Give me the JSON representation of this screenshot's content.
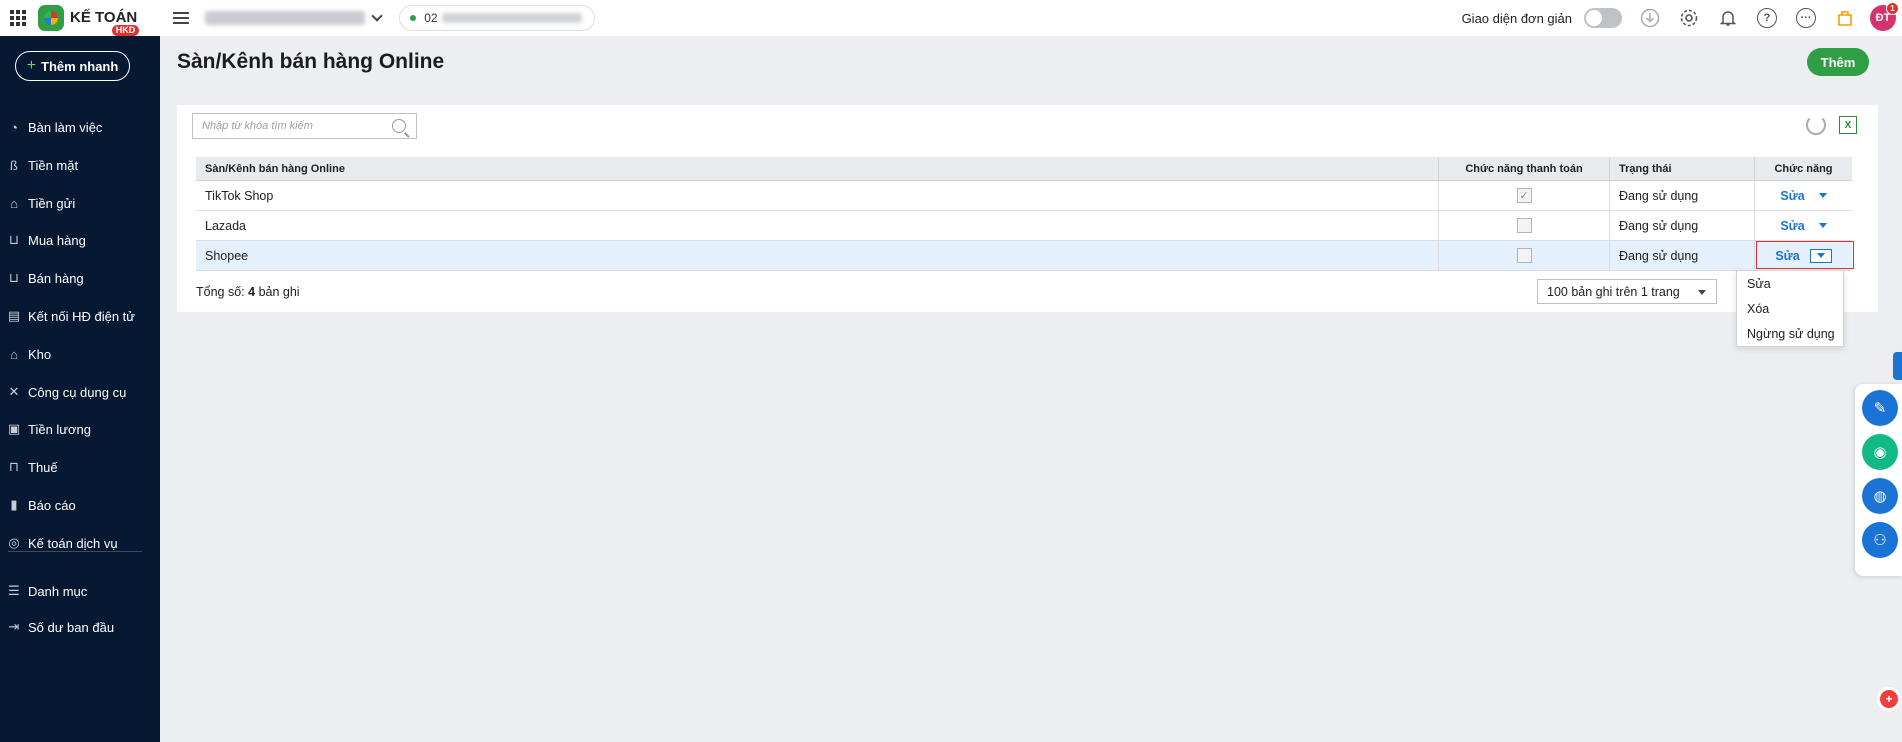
{
  "app": {
    "logo_text": "KẾ TOÁN",
    "logo_sub": "HKD"
  },
  "header": {
    "phone_prefix": "02",
    "simple_ui_label": "Giao diện đơn giản",
    "avatar_initials": "ĐT",
    "notification_badge": "1"
  },
  "sidebar": {
    "quick_add": "Thêm nhanh",
    "items": [
      {
        "label": "Bàn làm việc",
        "icon": "dashboard-icon"
      },
      {
        "label": "Tiền mặt",
        "icon": "cash-bag-icon"
      },
      {
        "label": "Tiền gửi",
        "icon": "bank-icon"
      },
      {
        "label": "Mua hàng",
        "icon": "cart-icon"
      },
      {
        "label": "Bán hàng",
        "icon": "shopping-cart-icon"
      },
      {
        "label": "Kết nối HĐ điện tử",
        "icon": "invoice-icon"
      },
      {
        "label": "Kho",
        "icon": "warehouse-icon"
      },
      {
        "label": "Công cụ dụng cụ",
        "icon": "tools-icon"
      },
      {
        "label": "Tiền lương",
        "icon": "payroll-icon"
      },
      {
        "label": "Thuế",
        "icon": "tax-icon"
      },
      {
        "label": "Báo cáo",
        "icon": "chart-icon"
      },
      {
        "label": "Kế toán dịch vụ",
        "icon": "service-icon"
      },
      {
        "label": "Danh mục",
        "icon": "list-icon"
      },
      {
        "label": "Số dư ban đầu",
        "icon": "opening-balance-icon"
      }
    ]
  },
  "page": {
    "title": "Sàn/Kênh bán hàng Online",
    "add_button": "Thêm",
    "search_placeholder": "Nhập từ khóa tìm kiếm"
  },
  "table": {
    "headers": [
      "Sàn/Kênh bán hàng Online",
      "Chức năng thanh toán",
      "Trạng thái",
      "Chức năng"
    ],
    "rows": [
      {
        "name": "TikTok Shop",
        "payment": true,
        "status": "Đang sử dụng",
        "action": "Sửa"
      },
      {
        "name": "Lazada",
        "payment": false,
        "status": "Đang sử dụng",
        "action": "Sửa"
      },
      {
        "name": "Shopee",
        "payment": false,
        "status": "Đang sử dụng",
        "action": "Sửa"
      }
    ],
    "selected_row": 2
  },
  "footer": {
    "total_label": "Tổng số:",
    "total_count": "4",
    "total_suffix": "bản ghi",
    "page_size": "100 bản ghi trên 1 trang"
  },
  "context_menu": {
    "items": [
      "Sửa",
      "Xóa",
      "Ngừng sử dụng"
    ]
  },
  "colors": {
    "sidebar_bg": "#071833",
    "primary_green": "#2f9e44",
    "link_blue": "#1c73d6",
    "highlight_red": "#e03131"
  }
}
